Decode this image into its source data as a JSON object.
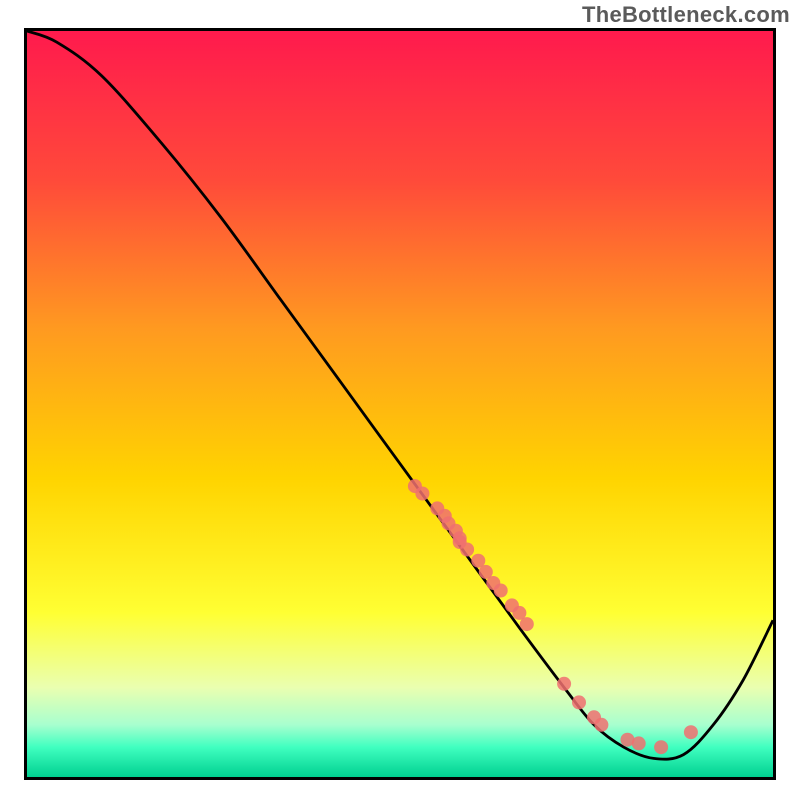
{
  "watermark": "TheBottleneck.com",
  "chart_data": {
    "type": "line",
    "title": "",
    "xlabel": "",
    "ylabel": "",
    "xlim": [
      0,
      100
    ],
    "ylim": [
      0,
      100
    ],
    "grid": false,
    "series": [
      {
        "name": "curve",
        "x": [
          0,
          4,
          10,
          18,
          26,
          34,
          42,
          50,
          58,
          66,
          72,
          76,
          80,
          84,
          88,
          92,
          96,
          100
        ],
        "y": [
          100,
          98.5,
          94,
          85,
          75,
          64,
          53,
          42,
          31,
          20,
          12,
          7,
          4,
          2.5,
          3,
          7,
          13,
          21
        ]
      }
    ],
    "scatter_points": {
      "name": "markers",
      "x": [
        52,
        53,
        55,
        56,
        56.5,
        57.5,
        58,
        58,
        59,
        60.5,
        61.5,
        62.5,
        63.5,
        65,
        66,
        67,
        72,
        74,
        76,
        77,
        80.5,
        82,
        85,
        89
      ],
      "y": [
        39,
        38,
        36,
        35,
        34,
        33,
        32,
        31.5,
        30.5,
        29,
        27.5,
        26,
        25,
        23,
        22,
        20.5,
        12.5,
        10,
        8,
        7,
        5,
        4.5,
        4,
        6
      ],
      "color": "#f07070",
      "radius": 7
    },
    "background_gradient": {
      "stops": [
        {
          "offset": 0.0,
          "color": "#ff1a4d"
        },
        {
          "offset": 0.2,
          "color": "#ff4a3a"
        },
        {
          "offset": 0.4,
          "color": "#ff9a20"
        },
        {
          "offset": 0.6,
          "color": "#ffd400"
        },
        {
          "offset": 0.78,
          "color": "#ffff33"
        },
        {
          "offset": 0.88,
          "color": "#eaffb0"
        },
        {
          "offset": 0.93,
          "color": "#a8ffcf"
        },
        {
          "offset": 0.96,
          "color": "#40ffc0"
        },
        {
          "offset": 1.0,
          "color": "#00d090"
        }
      ]
    }
  }
}
